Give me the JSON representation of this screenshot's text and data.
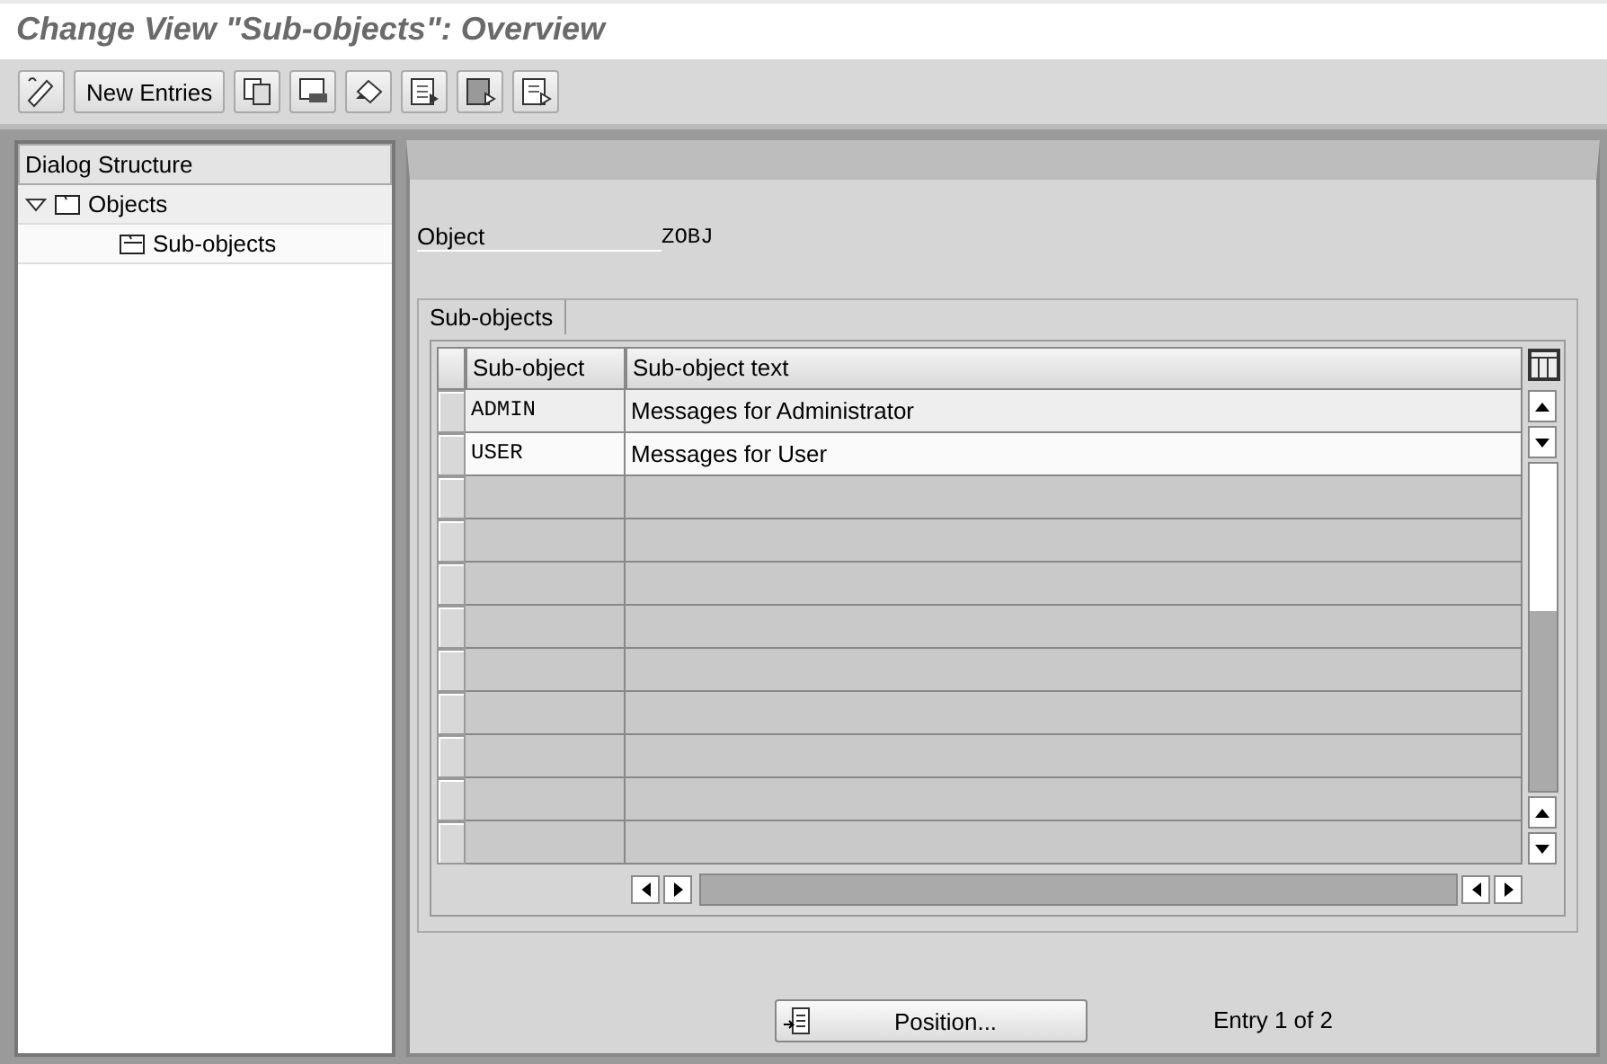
{
  "title": "Change View \"Sub-objects\": Overview",
  "toolbar": {
    "buttons": [
      {
        "kind": "edit"
      },
      {
        "kind": "text",
        "label": "New Entries"
      },
      {
        "kind": "copy"
      },
      {
        "kind": "delete"
      },
      {
        "kind": "undo"
      },
      {
        "kind": "select-all"
      },
      {
        "kind": "select-block"
      },
      {
        "kind": "deselect"
      }
    ]
  },
  "tree": {
    "title": "Dialog Structure",
    "items": [
      {
        "label": "Objects",
        "expanded": true,
        "selected": false,
        "children": [
          {
            "label": "Sub-objects",
            "selected": true
          }
        ]
      }
    ]
  },
  "object": {
    "label": "Object",
    "value": "ZOBJ"
  },
  "table": {
    "tab": "Sub-objects",
    "columns": [
      "Sub-object",
      "Sub-object text"
    ],
    "rows": [
      {
        "cells": [
          "ADMIN",
          "Messages for Administrator"
        ],
        "selected": false
      },
      {
        "cells": [
          "USER",
          "Messages for User"
        ],
        "selected": false
      }
    ]
  },
  "footer": {
    "button": "Position...",
    "entry": "Entry 1 of 2"
  }
}
